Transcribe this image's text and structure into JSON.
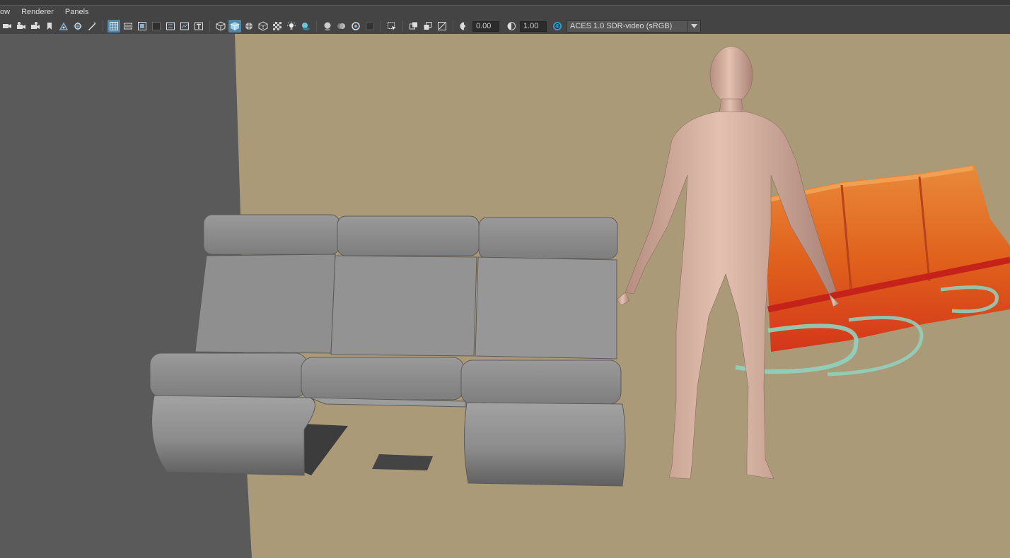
{
  "menubar": {
    "items": [
      {
        "label": "ow"
      },
      {
        "label": "Renderer"
      },
      {
        "label": "Panels"
      }
    ]
  },
  "toolbar": {
    "exposure_value": "0.00",
    "gamma_value": "1.00",
    "colorspace_value": "ACES 1.0 SDR-video (sRGB)",
    "icons": [
      "camera",
      "camera-select",
      "camera-tools",
      "bookmark",
      "image-plane",
      "2d-pan-zoom",
      "grease-pencil",
      "grid",
      "film-gate",
      "resolution-gate",
      "gate-mask",
      "field-chart",
      "safe-action",
      "safe-title",
      "wireframe",
      "smooth-shade",
      "wireframe-on-shaded",
      "xray",
      "default-material",
      "use-all-lights",
      "shadows",
      "screen-space-ao",
      "motion-blur",
      "anti-alias",
      "depth-of-field",
      "isolate-select",
      "xray-active",
      "xray-joints",
      "backface",
      "exposure",
      "gamma",
      "color-management"
    ]
  },
  "colors": {
    "viewport_floor": "#ab9a78",
    "viewport_background": "#5a5a5a",
    "active_icon": "#5285a6",
    "sofa_gray": "#8e8e8e",
    "human_skin": "#d6ad9c",
    "textured_sofa_orange": "#e0621c",
    "textured_sofa_glass": "#8fd3bf"
  }
}
